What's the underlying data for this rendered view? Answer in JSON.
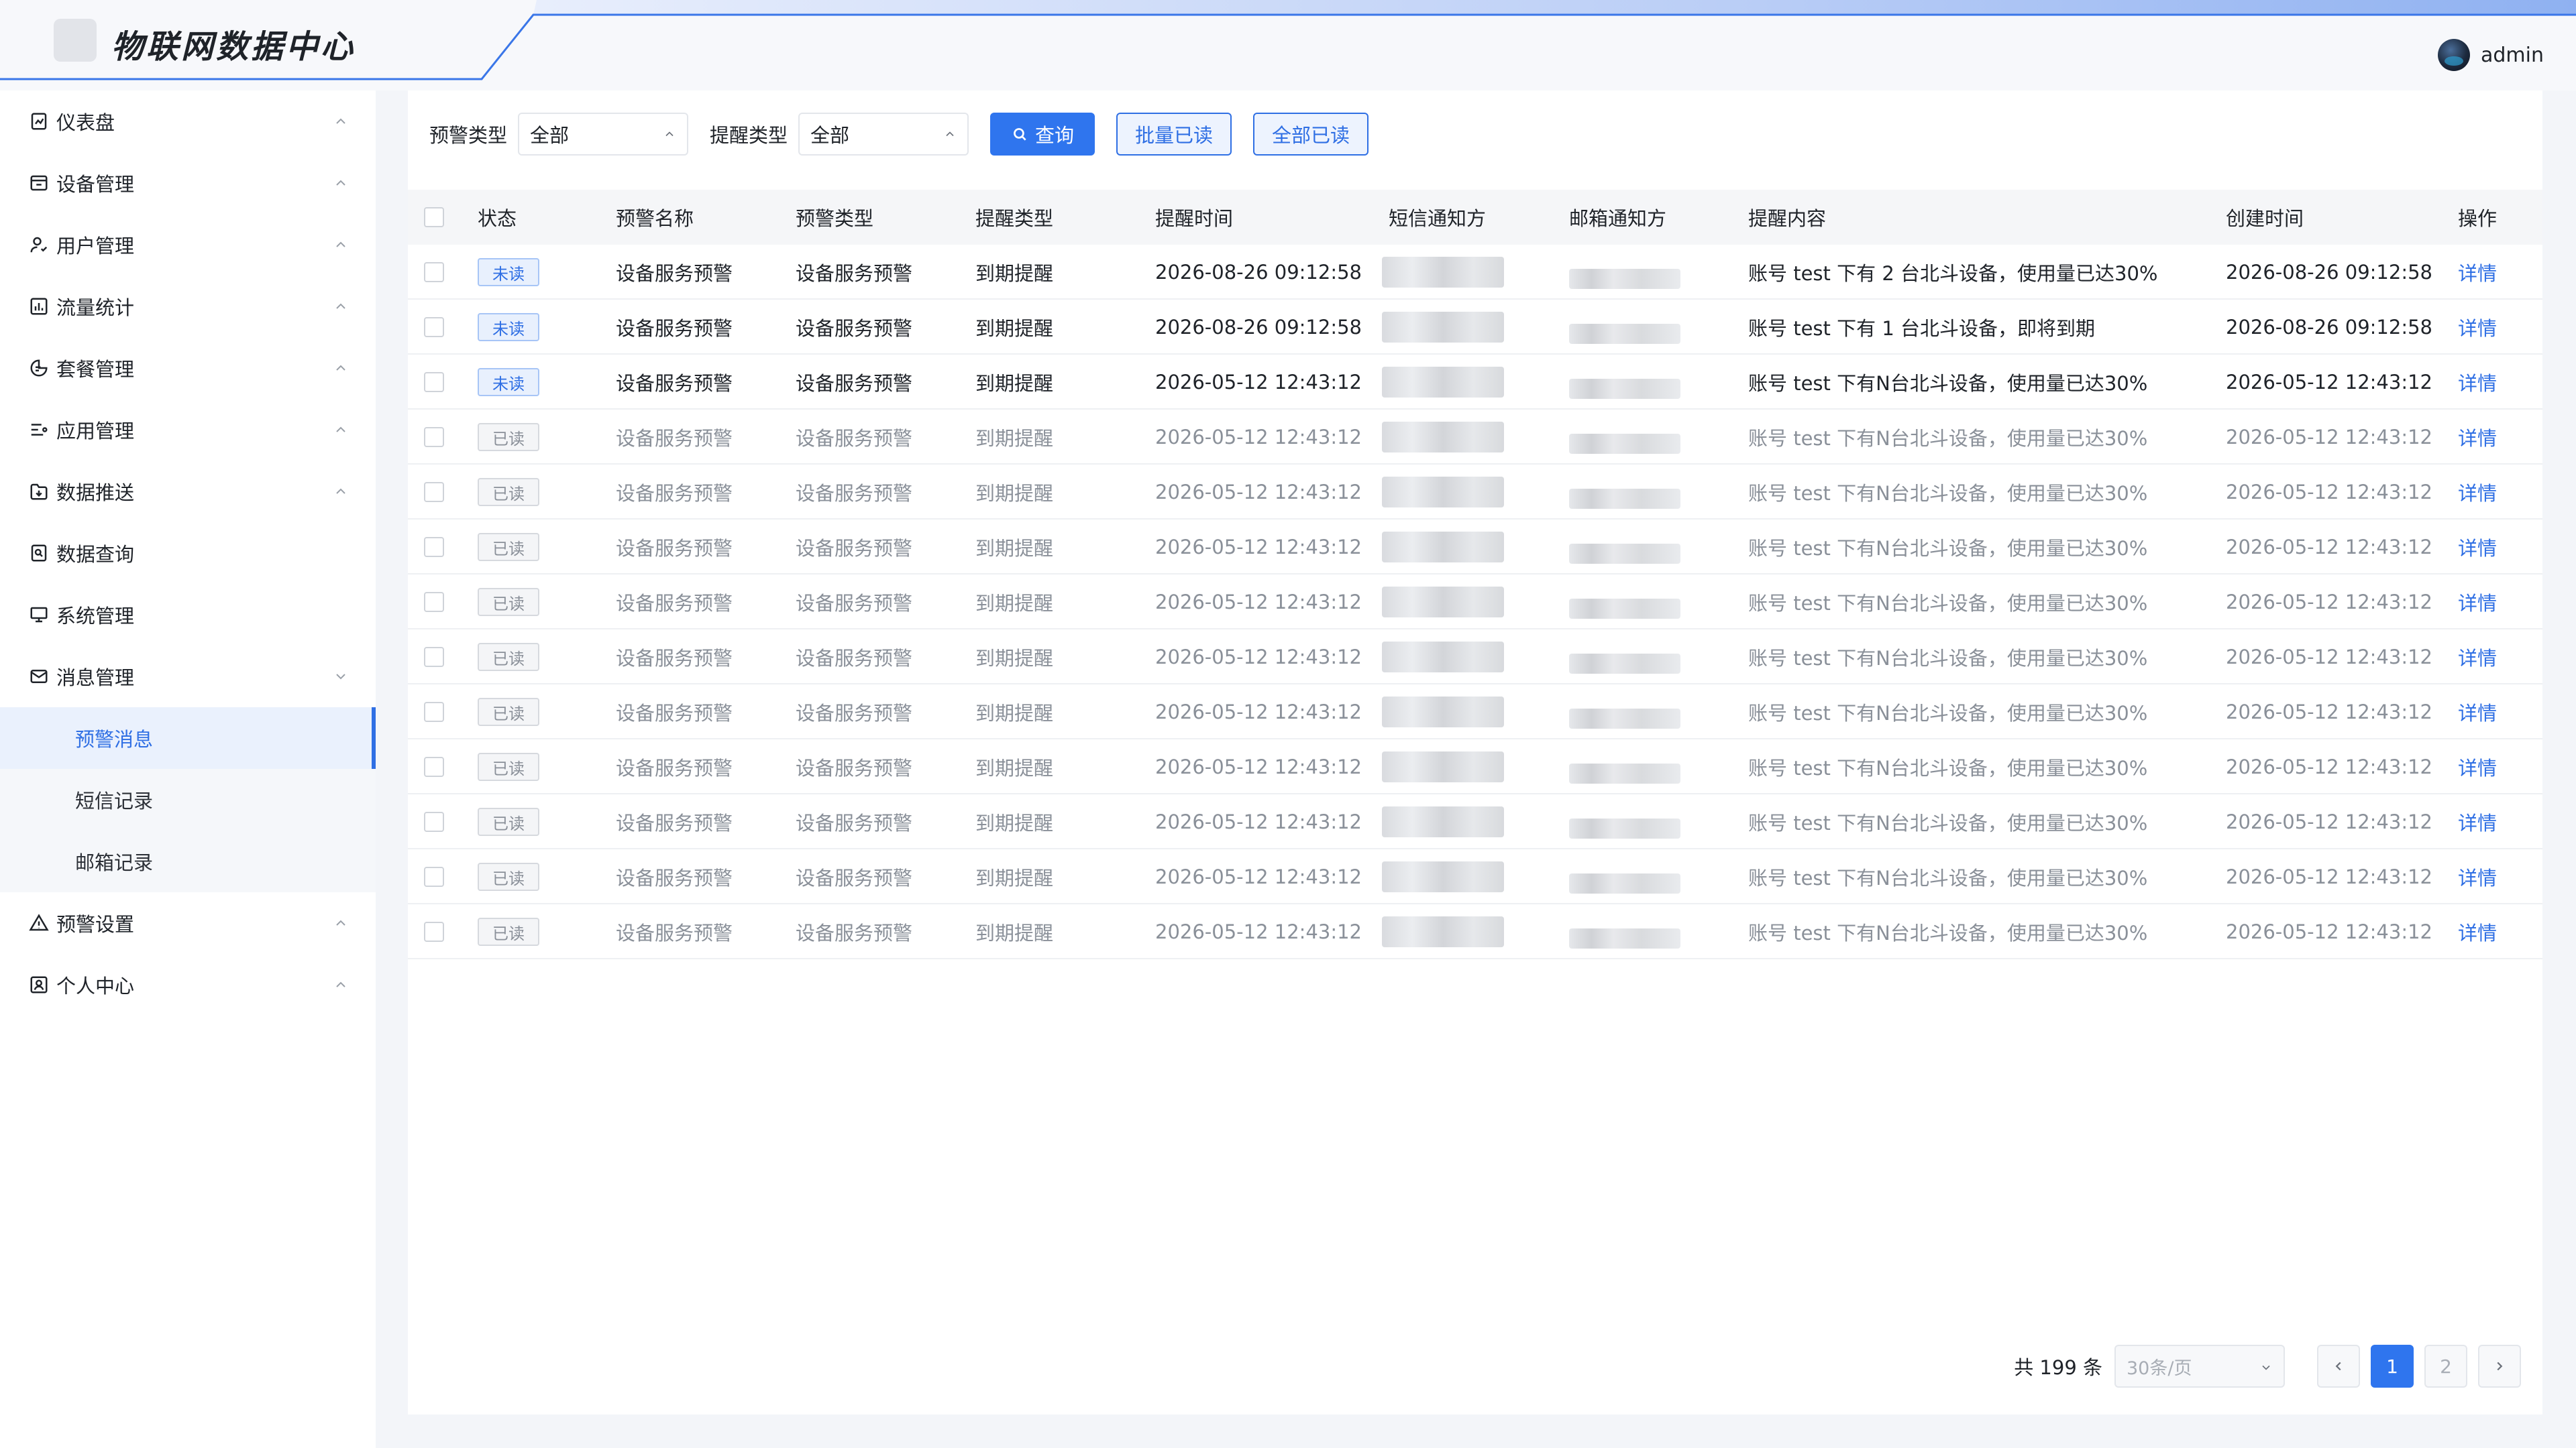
{
  "header": {
    "app_title": "物联网数据中心",
    "username": "admin"
  },
  "sidebar": {
    "items": [
      {
        "label": "仪表盘",
        "icon": "dashboard-icon"
      },
      {
        "label": "设备管理",
        "icon": "device-icon"
      },
      {
        "label": "用户管理",
        "icon": "user-icon"
      },
      {
        "label": "流量统计",
        "icon": "chart-icon"
      },
      {
        "label": "套餐管理",
        "icon": "package-icon"
      },
      {
        "label": "应用管理",
        "icon": "app-list-icon"
      },
      {
        "label": "数据推送",
        "icon": "push-icon"
      },
      {
        "label": "数据查询",
        "icon": "query-icon"
      },
      {
        "label": "系统管理",
        "icon": "monitor-icon"
      },
      {
        "label": "消息管理",
        "icon": "mail-icon"
      }
    ],
    "sub_items": [
      "预警消息",
      "短信记录",
      "邮箱记录"
    ],
    "bottom_items": [
      {
        "label": "预警设置",
        "icon": "warning-icon"
      },
      {
        "label": "个人中心",
        "icon": "profile-icon"
      }
    ]
  },
  "filters": {
    "alert_type_label": "预警类型",
    "alert_type_value": "全部",
    "remind_type_label": "提醒类型",
    "remind_type_value": "全部",
    "query_label": "查询",
    "batch_read_label": "批量已读",
    "all_read_label": "全部已读"
  },
  "table": {
    "columns": [
      "状态",
      "预警名称",
      "预警类型",
      "提醒类型",
      "提醒时间",
      "短信通知方",
      "邮箱通知方",
      "提醒内容",
      "创建时间",
      "操作"
    ],
    "rows": [
      {
        "status": "未读",
        "name": "设备服务预警",
        "alert_type": "设备服务预警",
        "remind_type": "到期提醒",
        "remind_time": "2026-08-26 09:12:58",
        "content": "账号 test 下有 2 台北斗设备，使用量已达30%",
        "created": "2026-08-26 09:12:58",
        "action": "详情"
      },
      {
        "status": "未读",
        "name": "设备服务预警",
        "alert_type": "设备服务预警",
        "remind_type": "到期提醒",
        "remind_time": "2026-08-26 09:12:58",
        "content": "账号 test 下有 1 台北斗设备，即将到期",
        "created": "2026-08-26 09:12:58",
        "action": "详情"
      },
      {
        "status": "未读",
        "name": "设备服务预警",
        "alert_type": "设备服务预警",
        "remind_type": "到期提醒",
        "remind_time": "2026-05-12 12:43:12",
        "content": "账号 test 下有N台北斗设备，使用量已达30%",
        "created": "2026-05-12 12:43:12",
        "action": "详情"
      },
      {
        "status": "已读",
        "name": "设备服务预警",
        "alert_type": "设备服务预警",
        "remind_type": "到期提醒",
        "remind_time": "2026-05-12 12:43:12",
        "content": "账号 test 下有N台北斗设备，使用量已达30%",
        "created": "2026-05-12 12:43:12",
        "action": "详情"
      },
      {
        "status": "已读",
        "name": "设备服务预警",
        "alert_type": "设备服务预警",
        "remind_type": "到期提醒",
        "remind_time": "2026-05-12 12:43:12",
        "content": "账号 test 下有N台北斗设备，使用量已达30%",
        "created": "2026-05-12 12:43:12",
        "action": "详情"
      },
      {
        "status": "已读",
        "name": "设备服务预警",
        "alert_type": "设备服务预警",
        "remind_type": "到期提醒",
        "remind_time": "2026-05-12 12:43:12",
        "content": "账号 test 下有N台北斗设备，使用量已达30%",
        "created": "2026-05-12 12:43:12",
        "action": "详情"
      },
      {
        "status": "已读",
        "name": "设备服务预警",
        "alert_type": "设备服务预警",
        "remind_type": "到期提醒",
        "remind_time": "2026-05-12 12:43:12",
        "content": "账号 test 下有N台北斗设备，使用量已达30%",
        "created": "2026-05-12 12:43:12",
        "action": "详情"
      },
      {
        "status": "已读",
        "name": "设备服务预警",
        "alert_type": "设备服务预警",
        "remind_type": "到期提醒",
        "remind_time": "2026-05-12 12:43:12",
        "content": "账号 test 下有N台北斗设备，使用量已达30%",
        "created": "2026-05-12 12:43:12",
        "action": "详情"
      },
      {
        "status": "已读",
        "name": "设备服务预警",
        "alert_type": "设备服务预警",
        "remind_type": "到期提醒",
        "remind_time": "2026-05-12 12:43:12",
        "content": "账号 test 下有N台北斗设备，使用量已达30%",
        "created": "2026-05-12 12:43:12",
        "action": "详情"
      },
      {
        "status": "已读",
        "name": "设备服务预警",
        "alert_type": "设备服务预警",
        "remind_type": "到期提醒",
        "remind_time": "2026-05-12 12:43:12",
        "content": "账号 test 下有N台北斗设备，使用量已达30%",
        "created": "2026-05-12 12:43:12",
        "action": "详情"
      },
      {
        "status": "已读",
        "name": "设备服务预警",
        "alert_type": "设备服务预警",
        "remind_type": "到期提醒",
        "remind_time": "2026-05-12 12:43:12",
        "content": "账号 test 下有N台北斗设备，使用量已达30%",
        "created": "2026-05-12 12:43:12",
        "action": "详情"
      },
      {
        "status": "已读",
        "name": "设备服务预警",
        "alert_type": "设备服务预警",
        "remind_type": "到期提醒",
        "remind_time": "2026-05-12 12:43:12",
        "content": "账号 test 下有N台北斗设备，使用量已达30%",
        "created": "2026-05-12 12:43:12",
        "action": "详情"
      },
      {
        "status": "已读",
        "name": "设备服务预警",
        "alert_type": "设备服务预警",
        "remind_type": "到期提醒",
        "remind_time": "2026-05-12 12:43:12",
        "content": "账号 test 下有N台北斗设备，使用量已达30%",
        "created": "2026-05-12 12:43:12",
        "action": "详情"
      }
    ]
  },
  "pagination": {
    "total_text": "共 199 条",
    "page_size": "30条/页",
    "pages": [
      "1",
      "2"
    ],
    "current_page": "1"
  },
  "colors": {
    "primary": "#2f75ee",
    "unread_tag": "#e8f0fd",
    "read_tag": "#f4f5f7"
  }
}
